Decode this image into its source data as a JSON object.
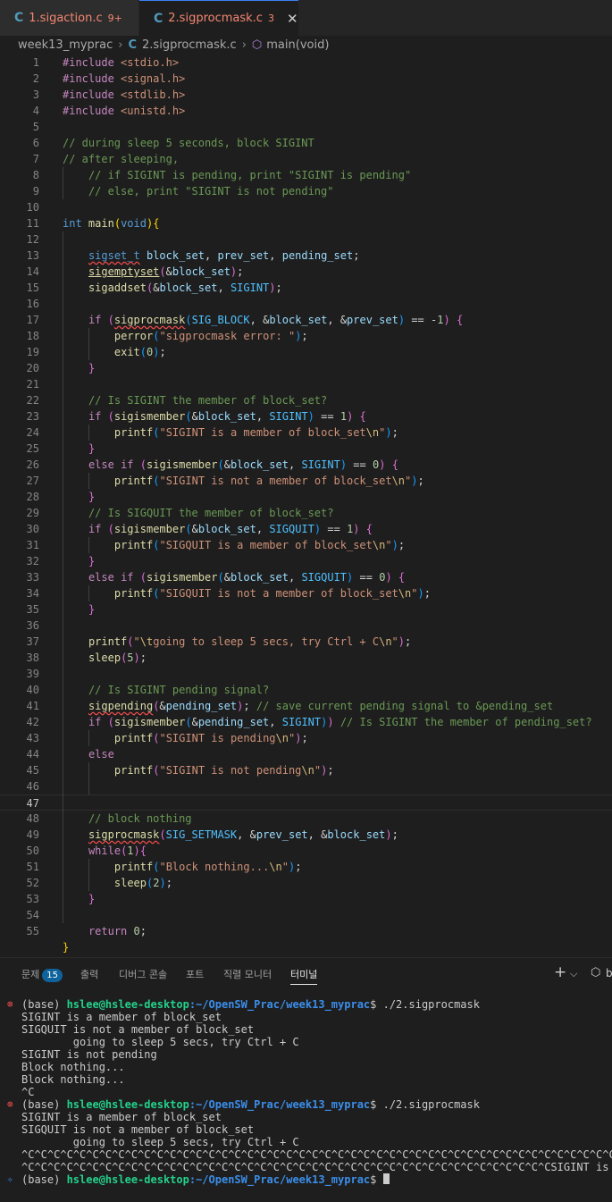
{
  "tabs": [
    {
      "icon": "C",
      "name": "1.sigaction.c",
      "badge": "9+"
    },
    {
      "icon": "C",
      "name": "2.sigprocmask.c",
      "badge": "3",
      "close": "✕"
    }
  ],
  "breadcrumb": {
    "folder": "week13_myprac",
    "file": "2.sigprocmask.c",
    "symbol": "main(void)"
  },
  "editor": {
    "line_numbers": [
      "1",
      "2",
      "3",
      "4",
      "5",
      "6",
      "7",
      "8",
      "9",
      "10",
      "11",
      "12",
      "13",
      "14",
      "15",
      "16",
      "17",
      "18",
      "19",
      "20",
      "21",
      "22",
      "23",
      "24",
      "25",
      "26",
      "27",
      "28",
      "29",
      "30",
      "31",
      "32",
      "33",
      "34",
      "35",
      "36",
      "37",
      "38",
      "39",
      "40",
      "41",
      "42",
      "43",
      "44",
      "45",
      "46",
      "47",
      "48",
      "49",
      "50",
      "51",
      "52",
      "53",
      "54",
      "55"
    ],
    "current_line": "47",
    "lines": [
      "#include <stdio.h>",
      "#include <signal.h>",
      "#include <stdlib.h>",
      "#include <unistd.h>",
      "",
      "// during sleep 5 seconds, block SIGINT",
      "// after sleeping,",
      "    // if SIGINT is pending, print \"SIGINT is pending\"",
      "    // else, print \"SIGINT is not pending\"",
      "",
      "int main(void){",
      "",
      "    sigset_t block_set, prev_set, pending_set;",
      "    sigemptyset(&block_set);",
      "    sigaddset(&block_set, SIGINT);",
      "",
      "    if (sigprocmask(SIG_BLOCK, &block_set, &prev_set) == -1) {",
      "        perror(\"sigprocmask error: \");",
      "        exit(0);",
      "    }",
      "",
      "    // Is SIGINT the member of block_set?",
      "    if (sigismember(&block_set, SIGINT) == 1) {",
      "        printf(\"SIGINT is a member of block_set\\n\");",
      "    }",
      "    else if (sigismember(&block_set, SIGINT) == 0) {",
      "        printf(\"SIGINT is not a member of block_set\\n\");",
      "    }",
      "    // Is SIGQUIT the member of block_set?",
      "    if (sigismember(&block_set, SIGQUIT) == 1) {",
      "        printf(\"SIGQUIT is a member of block_set\\n\");",
      "    }",
      "    else if (sigismember(&block_set, SIGQUIT) == 0) {",
      "        printf(\"SIGQUIT is not a member of block_set\\n\");",
      "    }",
      "",
      "    printf(\"\\tgoing to sleep 5 secs, try Ctrl + C\\n\");",
      "    sleep(5);",
      "",
      "    // Is SIGINT pending signal?",
      "    sigpending(&pending_set); // save current pending signal to &pending_set",
      "    if (sigismember(&pending_set, SIGINT)) // Is SIGINT the member of pending_set?",
      "        printf(\"SIGINT is pending\\n\");",
      "    else",
      "        printf(\"SIGINT is not pending\\n\");",
      "",
      "",
      "    // block nothing",
      "    sigprocmask(SIG_SETMASK, &prev_set, &block_set);",
      "    while(1){",
      "        printf(\"Block nothing...\\n\");",
      "        sleep(2);",
      "    }",
      "",
      "    return 0;",
      "}"
    ]
  },
  "panel": {
    "tabs": [
      {
        "label": "문제",
        "badge": "15"
      },
      {
        "label": "출력"
      },
      {
        "label": "디버그 콘솔"
      },
      {
        "label": "포트"
      },
      {
        "label": "직렬 모니터"
      },
      {
        "label": "터미널",
        "active": true
      }
    ],
    "add_icon": "+",
    "dropdown_icon": "⌵",
    "overflow_text": "b"
  },
  "terminal": {
    "lines": [
      {
        "mark": "⊗",
        "prefix": "(base) ",
        "user": "hslee@hslee-desktop",
        "path": ":~/OpenSW_Prac/week13_myprac",
        "cmd": "$ ./2.sigprocmask"
      },
      {
        "text": "SIGINT is a member of block_set"
      },
      {
        "text": "SIGQUIT is not a member of block_set"
      },
      {
        "text": "        going to sleep 5 secs, try Ctrl + C"
      },
      {
        "text": "SIGINT is not pending"
      },
      {
        "text": "Block nothing..."
      },
      {
        "text": "Block nothing..."
      },
      {
        "text": "^C"
      },
      {
        "mark": "⊗",
        "prefix": "(base) ",
        "user": "hslee@hslee-desktop",
        "path": ":~/OpenSW_Prac/week13_myprac",
        "cmd": "$ ./2.sigprocmask"
      },
      {
        "text": "SIGINT is a member of block_set"
      },
      {
        "text": "SIGQUIT is not a member of block_set"
      },
      {
        "text": "        going to sleep 5 secs, try Ctrl + C"
      },
      {
        "text": "^C^C^C^C^C^C^C^C^C^C^C^C^C^C^C^C^C^C^C^C^C^C^C^C^C^C^C^C^C^C^C^C^C^C^C^C^C^C^C^C^C^C^C^C^C^C^C^C^C^C^C^C^C^C^C^C^C^C^C"
      },
      {
        "text": "^C^C^C^C^C^C^C^C^C^C^C^C^C^C^C^C^C^C^C^C^C^C^C^C^C^C^C^C^C^C^C^C^C^C^C^C^C^C^C^C^CSIGINT is pending"
      },
      {
        "mark": "✧",
        "prefix": "(base) ",
        "user": "hslee@hslee-desktop",
        "path": ":~/OpenSW_Prac/week13_myprac",
        "cmd": "$ ",
        "cursor": true
      }
    ]
  },
  "colors": {
    "accent": "#3b82f6",
    "error": "#f14c4c",
    "prompt_user": "#23d18b",
    "prompt_path": "#3b8eea",
    "badge": "#0e639c"
  }
}
